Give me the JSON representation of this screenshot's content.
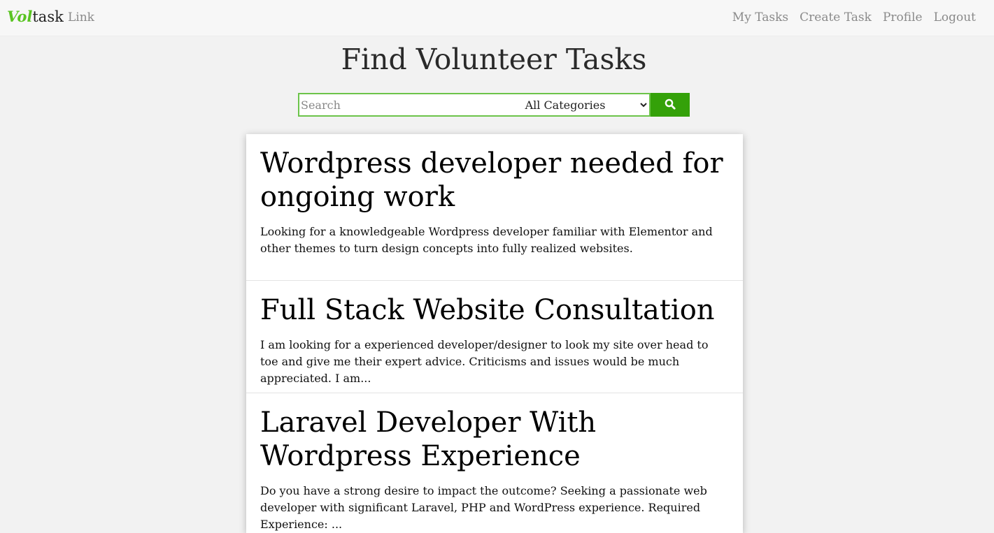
{
  "nav": {
    "brand_prefix": "Vol",
    "brand_suffix": "task",
    "link_label": "Link",
    "my_tasks": "My Tasks",
    "create_task": "Create Task",
    "profile": "Profile",
    "logout": "Logout"
  },
  "page": {
    "title": "Find Volunteer Tasks"
  },
  "search": {
    "placeholder": "Search",
    "value": "",
    "category_selected": "All Categories",
    "button_icon": "search-icon"
  },
  "colors": {
    "brand_green": "#5ac423",
    "search_button": "#34a109",
    "search_border": "#6cc44a",
    "background": "#f2f2f2"
  },
  "tasks": [
    {
      "title": "Wordpress developer needed for ongoing work",
      "description": "Looking for a knowledgeable Wordpress developer familiar with Elementor and other themes to turn design concepts into fully realized websites."
    },
    {
      "title": "Full Stack Website Consultation",
      "description": "I am looking for a experienced developer/designer to look my site over head to toe and give me their expert advice. Criticisms and issues would be much appreciated. I am..."
    },
    {
      "title": "Laravel Developer With Wordpress Experience",
      "description": "Do you have a strong desire to impact the outcome? Seeking a passionate web developer with significant Laravel, PHP and WordPress experience. Required Experience: ..."
    }
  ]
}
